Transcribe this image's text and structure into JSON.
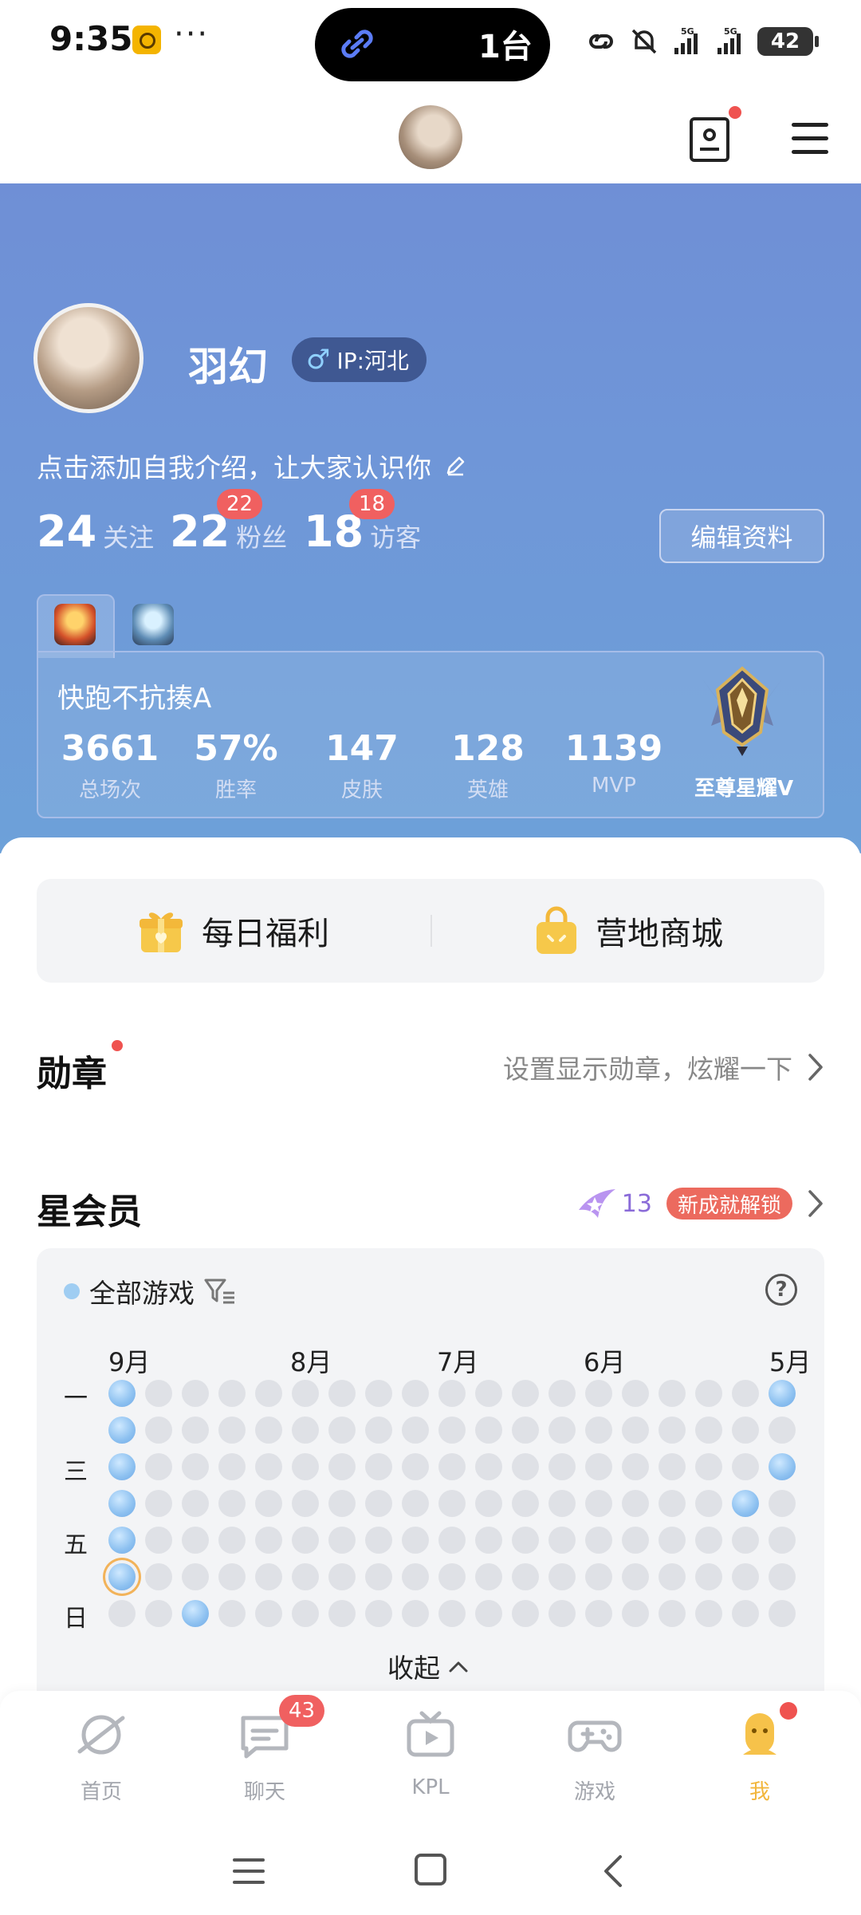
{
  "status_bar": {
    "time": "9:35",
    "dots": "···",
    "island_text": "1台",
    "battery": "42",
    "signal1": "5G",
    "signal2": "5G"
  },
  "profile": {
    "username": "羽幻",
    "gender_symbol": "♂",
    "ip_label": "IP:河北",
    "intro_prompt": "点击添加自我介绍，让大家认识你",
    "edit_button": "编辑资料",
    "stats": {
      "following_count": "24",
      "following_label": "关注",
      "fans_count": "22",
      "fans_label": "粉丝",
      "fans_badge": "22",
      "visitors_count": "18",
      "visitors_label": "访客",
      "visitors_badge": "18"
    }
  },
  "game_card": {
    "player_name": "快跑不抗揍A",
    "stats": [
      {
        "value": "3661",
        "label": "总场次"
      },
      {
        "value": "57%",
        "label": "胜率"
      },
      {
        "value": "147",
        "label": "皮肤"
      },
      {
        "value": "128",
        "label": "英雄"
      },
      {
        "value": "1139",
        "label": "MVP"
      }
    ],
    "rank": "至尊星耀V"
  },
  "welfare": {
    "daily": "每日福利",
    "mall": "营地商城"
  },
  "badges_section": {
    "title": "勋章",
    "action": "设置显示勋章，炫耀一下"
  },
  "vip_section": {
    "title": "星会员",
    "level": "13",
    "unlock": "新成就解锁"
  },
  "activity_calendar": {
    "filter_label": "全部游戏",
    "help": "?",
    "months": [
      "9月",
      "8月",
      "7月",
      "6月",
      "5月"
    ],
    "weekdays": [
      "一",
      "三",
      "五",
      "日"
    ],
    "collapse": "收起",
    "active_cells": [
      [
        0,
        0
      ],
      [
        0,
        1
      ],
      [
        0,
        2
      ],
      [
        0,
        3
      ],
      [
        0,
        4
      ],
      [
        0,
        5
      ],
      [
        2,
        6
      ],
      [
        18,
        0
      ],
      [
        18,
        2
      ],
      [
        17,
        3
      ]
    ],
    "today_cell": [
      0,
      5
    ],
    "colors": {
      "active": "#8cc0f0",
      "inactive": "#dfe1e6",
      "today_ring": "#f2b35a"
    }
  },
  "bottom_nav": {
    "items": [
      {
        "label": "首页",
        "icon": "home-planet-icon"
      },
      {
        "label": "聊天",
        "icon": "chat-icon"
      },
      {
        "label": "KPL",
        "icon": "tv-play-icon"
      },
      {
        "label": "游戏",
        "icon": "gamepad-icon"
      },
      {
        "label": "我",
        "icon": "me-icon"
      }
    ],
    "chat_badge": "43",
    "active_color": "#f2b63c"
  }
}
